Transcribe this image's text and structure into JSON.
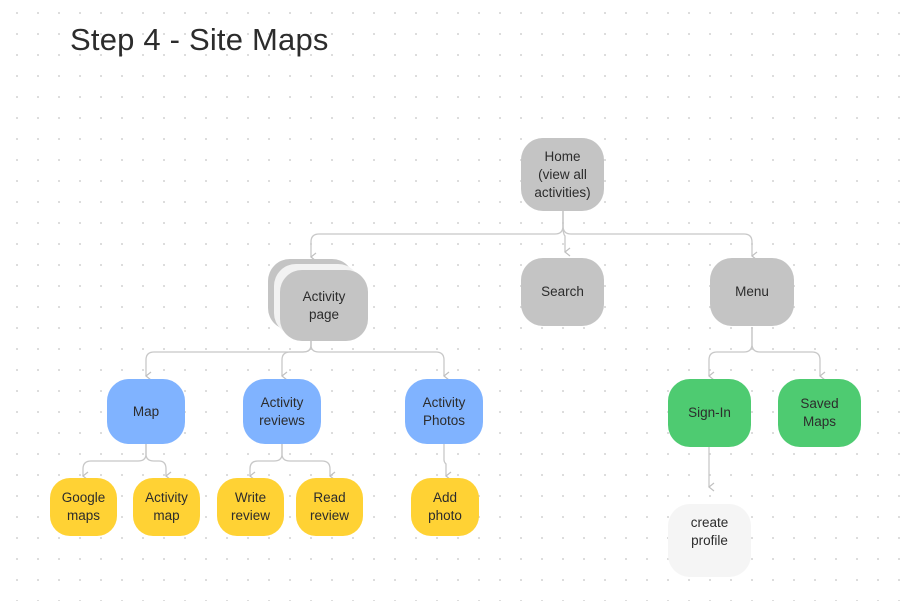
{
  "title": "Step 4 - Site Maps",
  "colors": {
    "gray": "#c4c4c4",
    "blue": "#80b3ff",
    "yellow": "#ffd234",
    "green": "#4ecb71",
    "light": "#f5f5f5",
    "connector": "#c8c8c8"
  },
  "nodes": {
    "home": "Home\n(view all\nactivities)",
    "activity_page": "Activity\npage",
    "search": "Search",
    "menu": "Menu",
    "map": "Map",
    "activity_reviews": "Activity\nreviews",
    "activity_photos": "Activity\nPhotos",
    "google_maps": "Google\nmaps",
    "activity_map": "Activity\nmap",
    "write_review": "Write\nreview",
    "read_review": "Read\nreview",
    "add_photo": "Add\nphoto",
    "sign_in": "Sign-In",
    "saved_maps": "Saved\nMaps",
    "create_profile": "create\nprofile"
  },
  "edges": [
    [
      "home",
      "activity_page"
    ],
    [
      "home",
      "search"
    ],
    [
      "home",
      "menu"
    ],
    [
      "activity_page",
      "map"
    ],
    [
      "activity_page",
      "activity_reviews"
    ],
    [
      "activity_page",
      "activity_photos"
    ],
    [
      "map",
      "google_maps"
    ],
    [
      "map",
      "activity_map"
    ],
    [
      "activity_reviews",
      "write_review"
    ],
    [
      "activity_reviews",
      "read_review"
    ],
    [
      "activity_photos",
      "add_photo"
    ],
    [
      "menu",
      "sign_in"
    ],
    [
      "menu",
      "saved_maps"
    ],
    [
      "sign_in",
      "create_profile"
    ]
  ]
}
